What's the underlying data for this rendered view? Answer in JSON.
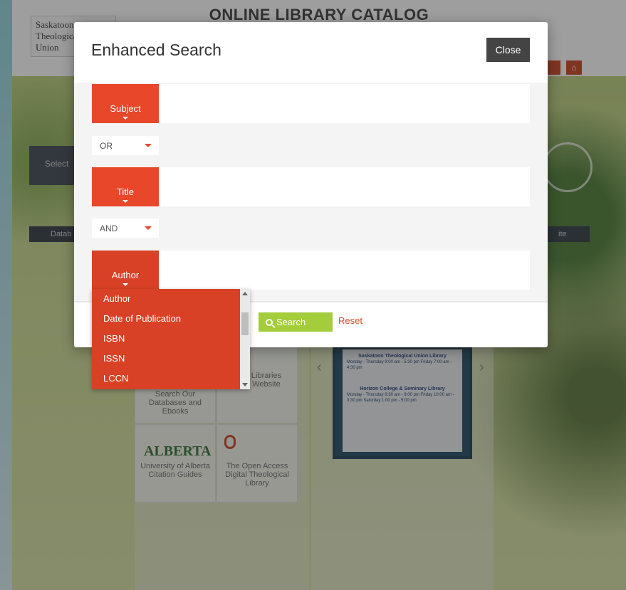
{
  "background": {
    "header_title": "ONLINE LIBRARY CATALOG",
    "logo_lines": [
      "Saskatoon",
      "Theological",
      "Union"
    ],
    "select_label": "Select",
    "databases_label": "Datab",
    "website_label": "ite",
    "tiles": {
      "databases": "Search Our Databases and Ebooks",
      "libraries": "Libraries Website",
      "alberta_logo": "ALBERTA",
      "alberta_label": "University of Alberta Citation Guides",
      "open_access": "The Open Access Digital Theological Library"
    },
    "poster": {
      "heading1": "Saskatoon Theological Union Library",
      "hours1": "Monday - Thursday 9:00 am - 5:30 pm  Friday 7:00 am - 4:30 pm",
      "heading2": "Horizon College & Seminary Library",
      "hours2": "Monday - Thursday 8:30 am - 9:00 pm  Friday 10:00 am - 3:30 pm  Saturday 1:00 pm - 5:00 pm"
    }
  },
  "modal": {
    "title": "Enhanced Search",
    "close_label": "Close",
    "rows": [
      {
        "field": "Subject",
        "value": ""
      },
      {
        "field": "Title",
        "value": ""
      },
      {
        "field": "Author",
        "value": ""
      }
    ],
    "operators": [
      "OR",
      "AND"
    ],
    "search_label": "Search",
    "reset_label": "Reset"
  },
  "dropdown": {
    "options": [
      "Author",
      "Date of Publication",
      "ISBN",
      "ISSN",
      "LCCN"
    ]
  },
  "colors": {
    "accent": "#e8472a",
    "search_green": "#a3cd3b",
    "close_dark": "#444444"
  }
}
